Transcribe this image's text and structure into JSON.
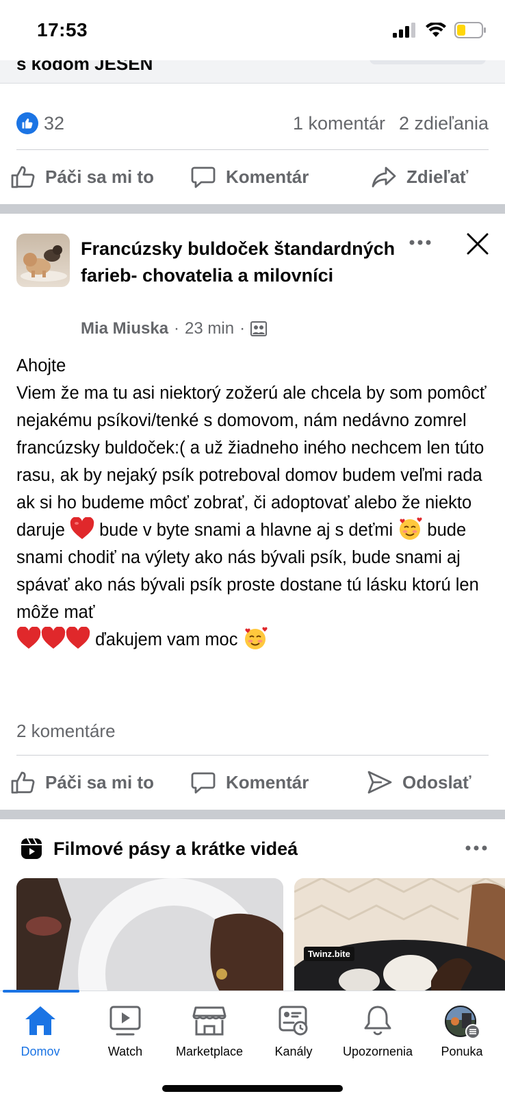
{
  "status_bar": {
    "time": "17:53"
  },
  "prev_post": {
    "cut_text": "s kódom JESEN",
    "likes": "32",
    "comments": "1 komentár",
    "shares": "2 zdieľania",
    "actions": {
      "like": "Páči sa mi to",
      "comment": "Komentár",
      "share": "Zdieľať"
    }
  },
  "post": {
    "group_name": "Francúzsky buldoček štandardných farieb- chovatelia a milovníci",
    "author": "Mia Miuska",
    "time": "23 min",
    "dot": "·",
    "body": {
      "greeting": "Ahojte",
      "line_1": "Viem že ma tu asi niektorý zožerú ale chcela by som pomôcť nejakému psíkovi/tenké s domovom, nám nedávno zomrel francúzsky buldoček:( a už žiadneho iného nechcem len túto rasu, ak by nejaký psík potreboval domov budem veľmi rada ak si ho budeme môcť zobrať, či adoptovať alebo že niekto daruje",
      "line_2": "bude v byte snami a hlavne aj s deťmi",
      "line_3": "bude snami chodiť na výlety ako nás bývali psík, bude snami aj spávať ako nás bývali psík proste dostane tú lásku ktorú len môže mať",
      "line_4": "ďakujem vam moc"
    },
    "comments_count": "2 komentáre",
    "actions": {
      "like": "Páči sa mi to",
      "comment": "Komentár",
      "send": "Odoslať"
    }
  },
  "reels": {
    "title": "Filmové pásy a krátke videá",
    "items": [
      {
        "label": ""
      },
      {
        "label": "Twinz.bite"
      }
    ]
  },
  "tabbar": {
    "tabs": [
      {
        "label": "Domov",
        "icon": "home-icon",
        "active": true
      },
      {
        "label": "Watch",
        "icon": "watch-icon"
      },
      {
        "label": "Marketplace",
        "icon": "marketplace-icon"
      },
      {
        "label": "Kanály",
        "icon": "feeds-icon"
      },
      {
        "label": "Upozornenia",
        "icon": "bell-icon"
      },
      {
        "label": "Ponuka",
        "icon": "profile-menu-icon"
      }
    ]
  },
  "colors": {
    "accent": "#1b74e4",
    "secondary_text": "#65676b",
    "separator": "#c9ccd1",
    "heart": "#e0282b"
  }
}
